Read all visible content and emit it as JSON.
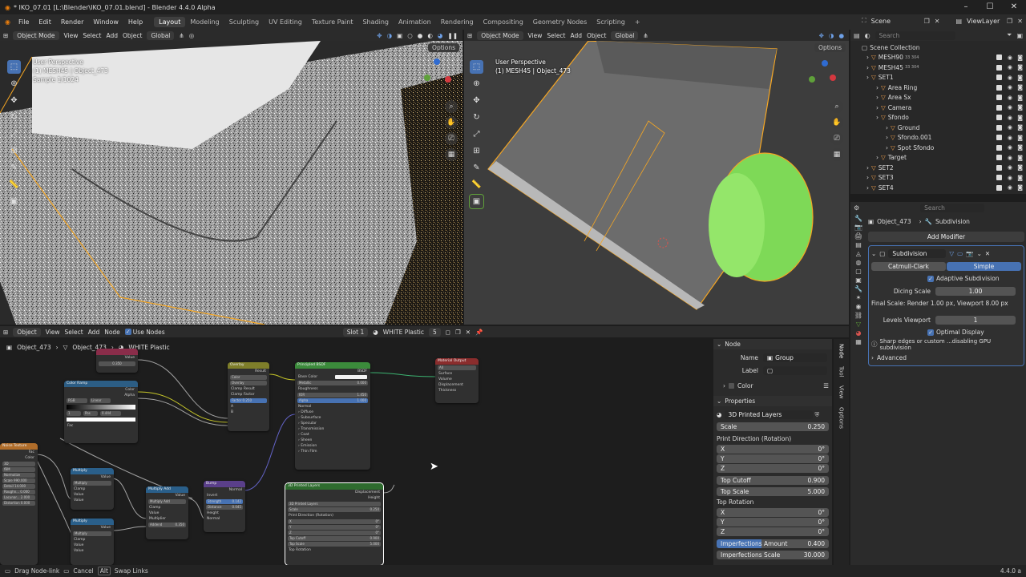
{
  "window": {
    "title": "* IKO_07.01 [L:\\Blender\\IKO_07.01.blend] - Blender 4.4.0 Alpha"
  },
  "menus": [
    "File",
    "Edit",
    "Render",
    "Window",
    "Help"
  ],
  "workspaces": [
    "Layout",
    "Modeling",
    "Sculpting",
    "UV Editing",
    "Texture Paint",
    "Shading",
    "Animation",
    "Rendering",
    "Compositing",
    "Geometry Nodes",
    "Scripting"
  ],
  "scene": {
    "scene_label": "Scene",
    "viewlayer_label": "ViewLayer"
  },
  "viewport_left": {
    "mode": "Object Mode",
    "menus": [
      "View",
      "Select",
      "Add",
      "Object"
    ],
    "orientation": "Global",
    "options": "Options",
    "overlay_lines": [
      "User Perspective",
      "(1) MESH45 | Object_473",
      "Sample 1/1024"
    ]
  },
  "viewport_right": {
    "mode": "Object Mode",
    "menus": [
      "View",
      "Select",
      "Add",
      "Object"
    ],
    "orientation": "Global",
    "options": "Options",
    "overlay_lines": [
      "User Perspective",
      "(1) MESH45 | Object_473"
    ]
  },
  "outliner": {
    "search_placeholder": "Search",
    "root": "Scene Collection",
    "items": [
      {
        "label": "MESH90",
        "indent": 1,
        "badge": "33 304"
      },
      {
        "label": "MESH45",
        "indent": 1,
        "badge": "33 304"
      },
      {
        "label": "SET1",
        "indent": 1,
        "badge": ""
      },
      {
        "label": "Area Ring",
        "indent": 2,
        "badge": ""
      },
      {
        "label": "Area Sx",
        "indent": 2,
        "badge": ""
      },
      {
        "label": "Camera",
        "indent": 2,
        "badge": ""
      },
      {
        "label": "Sfondo",
        "indent": 2,
        "badge": ""
      },
      {
        "label": "Ground",
        "indent": 3,
        "badge": ""
      },
      {
        "label": "Sfondo.001",
        "indent": 3,
        "badge": ""
      },
      {
        "label": "Spot Sfondo",
        "indent": 3,
        "badge": ""
      },
      {
        "label": "Target",
        "indent": 2,
        "badge": ""
      },
      {
        "label": "SET2",
        "indent": 1,
        "badge": ""
      },
      {
        "label": "SET3",
        "indent": 1,
        "badge": ""
      },
      {
        "label": "SET4",
        "indent": 1,
        "badge": ""
      }
    ]
  },
  "properties": {
    "search_placeholder": "Search",
    "object": "Object_473",
    "modifier_tab": "Subdivision",
    "add_modifier": "Add Modifier",
    "modifier_name": "Subdivision",
    "modes": [
      "Catmull-Clark",
      "Simple"
    ],
    "adaptive": "Adaptive Subdivision",
    "dicing_label": "Dicing Scale",
    "dicing_value": "1.00",
    "final_scale": "Final Scale: Render 1.00 px, Viewport 8.00 px",
    "levels_label": "Levels Viewport",
    "levels_value": "1",
    "optimal": "Optimal Display",
    "sharp_edges": "Sharp edges or custom ...disabling GPU subdivision",
    "advanced": "Advanced"
  },
  "node_editor": {
    "header": {
      "type": "Object",
      "menus": [
        "View",
        "Select",
        "Add",
        "Node"
      ],
      "use_nodes": "Use Nodes",
      "slot": "Slot 1",
      "material": "WHITE Plastic",
      "users": "5"
    },
    "breadcrumb": [
      "Object_473",
      "Object_473",
      "WHITE Plastic"
    ],
    "nodes": {
      "value_top": {
        "title": "",
        "value": "0.350"
      },
      "color_ramp": {
        "title": "Color Ramp",
        "out1": "Color",
        "out2": "Alpha",
        "mode": "RGB",
        "interp": "Linear",
        "pos_label": "Pos",
        "pos": "0.444",
        "idx": "1",
        "fac": "Fac"
      },
      "overlay": {
        "title": "Overlay",
        "out": "Result",
        "field1": "Color",
        "field2": "Overlay",
        "clamp_result": "Clamp Result",
        "clamp_factor": "Clamp Factor",
        "factor": "Factor",
        "factor_val": "0.250",
        "a": "A",
        "b": "B"
      },
      "bsdf": {
        "title": "Principled BSDF",
        "out": "BSDF",
        "rows": [
          "Base Color",
          "Metallic",
          "Roughness",
          "IOR",
          "Alpha",
          "Normal"
        ],
        "vals": [
          "",
          "0.000",
          "",
          "1.450",
          "1.000",
          ""
        ],
        "panels": [
          "Diffuse",
          "Subsurface",
          "Specular",
          "Transmission",
          "Coat",
          "Sheen",
          "Emission",
          "Thin Film"
        ]
      },
      "mat_out": {
        "title": "Material Output",
        "sel": "All",
        "rows": [
          "Surface",
          "Volume",
          "Displacement",
          "Thickness"
        ]
      },
      "noise": {
        "title": "Noise Texture",
        "outs": [
          "Fac",
          "Color"
        ],
        "fields": [
          "3D",
          "fBM",
          "Normalize",
          "Scale 990.000",
          "Detail 14.000",
          "Roughn... 0.000",
          "Lacunar... 2.000",
          "Distortion 0.000"
        ]
      },
      "mult1": {
        "title": "Multiply",
        "out": "Value",
        "op": "Multiply",
        "clamp": "Clamp",
        "ins": [
          "Value",
          "Value"
        ]
      },
      "mult2": {
        "title": "Multiply",
        "out": "Value",
        "op": "Multiply",
        "clamp": "Clamp",
        "ins": [
          "Value",
          "Value"
        ]
      },
      "multadd": {
        "title": "Multiply Add",
        "out": "Value",
        "op": "Multiply Add",
        "clamp": "Clamp",
        "ins": [
          "Value",
          "Multiplier",
          "Addend"
        ],
        "addend": "0.350"
      },
      "bump": {
        "title": "Bump",
        "out": "Normal",
        "invert": "Invert",
        "strength": "Strength",
        "strength_val": "0.142",
        "distance": "Distance",
        "distance_val": "0.045",
        "ins": [
          "Height",
          "Normal"
        ]
      },
      "printed": {
        "title": "3D Printed Layers",
        "outs": [
          "Displacement",
          "Height"
        ],
        "group": "3D Printed Layers",
        "scale": "Scale",
        "scale_val": "0.250",
        "print_dir": "Print Direction (Rotation)",
        "xyz": [
          "X",
          "Y",
          "Z"
        ],
        "deg": "0°",
        "top_cutoff": "Top Cutoff",
        "top_cutoff_val": "0.900",
        "top_scale": "Top Scale",
        "top_scale_val": "5.000",
        "top_rot": "Top Rotation"
      }
    }
  },
  "sidebar": {
    "node_section": "Node",
    "name_label": "Name",
    "name_value": "Group",
    "label_label": "Label",
    "color_label": "Color",
    "properties_section": "Properties",
    "group": "3D Printed Layers",
    "scale_label": "Scale",
    "scale_value": "0.250",
    "print_dir": "Print Direction (Rotation)",
    "axes": [
      "X",
      "Y",
      "Z"
    ],
    "deg": "0°",
    "top_cutoff": "Top Cutoff",
    "top_cutoff_val": "0.900",
    "top_scale": "Top Scale",
    "top_scale_val": "5.000",
    "top_rotation": "Top Rotation",
    "imperfections": "Imperfections Amount",
    "imperfections_val": "0.400",
    "imperfections_scale": "Imperfections Scale",
    "imperfections_scale_val": "30.000",
    "tabs": [
      "Node",
      "Tool",
      "View",
      "Options"
    ]
  },
  "statusbar": {
    "drag": "Drag Node-link",
    "cancel": "Cancel",
    "alt": "Alt",
    "swap": "Swap Links",
    "version": "4.4.0 a"
  },
  "colors": {
    "accent": "#4772b3",
    "selection": "#f5a623",
    "ramp_node": "#2c5d84",
    "shader_node": "#3b8b3b",
    "group_node": "#2e6b2e",
    "math_node": "#2a5f8a",
    "vector_node": "#5a3f8a",
    "texture_node": "#b06d2a",
    "green_object": "#7ed957"
  }
}
